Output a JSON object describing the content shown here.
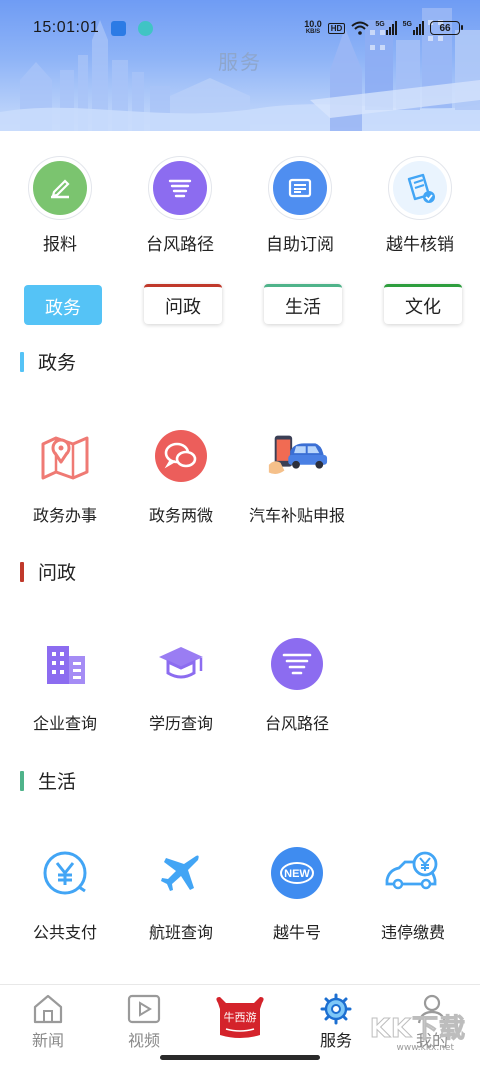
{
  "status_bar": {
    "time": "15:01:01",
    "net_speed": "10.0",
    "net_unit": "KB/S",
    "hd": "HD",
    "sim1": "5G",
    "sim2": "5G",
    "battery": "66"
  },
  "header": {
    "title": "服务"
  },
  "quick_links": [
    {
      "label": "报料",
      "icon": "edit-report-icon",
      "color": "#7bc46f"
    },
    {
      "label": "台风路径",
      "icon": "typhoon-icon",
      "color": "#8c6cf0"
    },
    {
      "label": "自助订阅",
      "icon": "newspaper-icon",
      "color": "#4f8ef0"
    },
    {
      "label": "越牛核销",
      "icon": "ticket-check-icon",
      "color": "#42a5f5"
    }
  ],
  "tabs": [
    {
      "label": "政务",
      "active": true,
      "color": "#55c3f6"
    },
    {
      "label": "问政",
      "active": false,
      "color": "#c0392b"
    },
    {
      "label": "生活",
      "active": false,
      "color": "#4fb38a"
    },
    {
      "label": "文化",
      "active": false,
      "color": "#2e9e3e"
    }
  ],
  "sections": [
    {
      "title": "政务",
      "color": "#55c3f6",
      "items": [
        {
          "label": "政务办事",
          "icon": "map-pin-icon"
        },
        {
          "label": "政务两微",
          "icon": "chat-bubbles-icon"
        },
        {
          "label": "汽车补贴申报",
          "icon": "car-subsidy-icon"
        }
      ]
    },
    {
      "title": "问政",
      "color": "#c0392b",
      "items": [
        {
          "label": "企业查询",
          "icon": "building-icon"
        },
        {
          "label": "学历查询",
          "icon": "graduation-cap-icon"
        },
        {
          "label": "台风路径",
          "icon": "typhoon-icon"
        }
      ]
    },
    {
      "title": "生活",
      "color": "#4fb38a",
      "items": [
        {
          "label": "公共支付",
          "icon": "yuan-payment-icon"
        },
        {
          "label": "航班查询",
          "icon": "airplane-icon"
        },
        {
          "label": "越牛号",
          "icon": "new-badge-icon"
        },
        {
          "label": "违停缴费",
          "icon": "car-fine-icon"
        }
      ]
    }
  ],
  "bottom_nav": [
    {
      "label": "新闻",
      "icon": "home-icon",
      "active": false
    },
    {
      "label": "视频",
      "icon": "video-play-icon",
      "active": false
    },
    {
      "label": "",
      "icon": "brand-logo-icon",
      "active": false
    },
    {
      "label": "服务",
      "icon": "gear-icon",
      "active": true
    },
    {
      "label": "我的",
      "icon": "user-icon",
      "active": false
    }
  ],
  "watermark": {
    "text": "KK下载",
    "url": "www.kkx.net"
  }
}
